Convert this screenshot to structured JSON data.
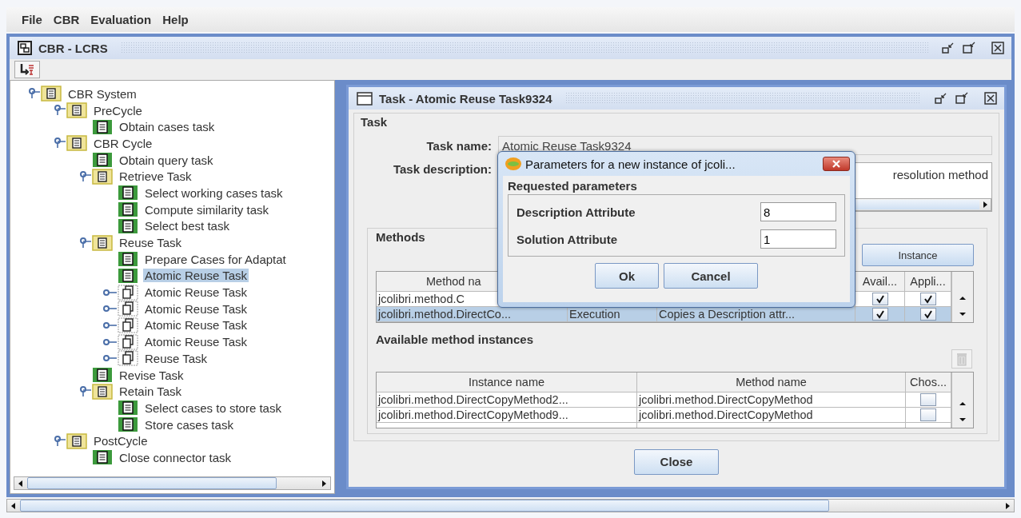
{
  "menu": [
    "File",
    "CBR",
    "Evaluation",
    "Help"
  ],
  "main_window": {
    "title": "CBR - LCRS"
  },
  "tree": [
    {
      "label": "CBR System",
      "kind": "folder",
      "expanded": true,
      "selected": false,
      "children": [
        {
          "label": "PreCycle",
          "kind": "folder",
          "expanded": true,
          "selected": false,
          "children": [
            {
              "label": "Obtain cases task",
              "kind": "task",
              "selected": false
            }
          ]
        },
        {
          "label": "CBR Cycle",
          "kind": "folder",
          "expanded": true,
          "selected": false,
          "children": [
            {
              "label": "Obtain query task",
              "kind": "task",
              "selected": false
            },
            {
              "label": "Retrieve Task",
              "kind": "folder",
              "expanded": true,
              "selected": false,
              "children": [
                {
                  "label": "Select working cases task",
                  "kind": "task",
                  "selected": false
                },
                {
                  "label": "Compute similarity task",
                  "kind": "task",
                  "selected": false
                },
                {
                  "label": "Select best task",
                  "kind": "task",
                  "selected": false
                }
              ]
            },
            {
              "label": "Reuse Task",
              "kind": "folder",
              "expanded": true,
              "selected": false,
              "children": [
                {
                  "label": "Prepare Cases for Adaptat",
                  "kind": "task",
                  "selected": false
                },
                {
                  "label": "Atomic Reuse Task",
                  "kind": "task",
                  "selected": true
                },
                {
                  "label": "Atomic Reuse Task",
                  "kind": "instance",
                  "expanded": false,
                  "selected": false
                },
                {
                  "label": "Atomic Reuse Task",
                  "kind": "instance",
                  "expanded": false,
                  "selected": false
                },
                {
                  "label": "Atomic Reuse Task",
                  "kind": "instance",
                  "expanded": false,
                  "selected": false
                },
                {
                  "label": "Atomic Reuse Task",
                  "kind": "instance",
                  "expanded": false,
                  "selected": false
                },
                {
                  "label": "Reuse Task",
                  "kind": "instance",
                  "expanded": false,
                  "selected": false
                }
              ]
            },
            {
              "label": "Revise Task",
              "kind": "task",
              "selected": false
            },
            {
              "label": "Retain Task",
              "kind": "folder",
              "expanded": true,
              "selected": false,
              "children": [
                {
                  "label": "Select cases to store task",
                  "kind": "task",
                  "selected": false
                },
                {
                  "label": "Store cases task",
                  "kind": "task",
                  "selected": false
                }
              ]
            }
          ]
        },
        {
          "label": "PostCycle",
          "kind": "folder",
          "expanded": true,
          "selected": false,
          "children": [
            {
              "label": "Close connector task",
              "kind": "task",
              "selected": false
            }
          ]
        }
      ]
    }
  ],
  "task_window": {
    "title": "Task - Atomic Reuse Task9324",
    "section": "Task",
    "task_name_label": "Task name:",
    "task_name": "Atomic Reuse Task9324",
    "task_description_label": "Task description:",
    "task_description": "resolution method",
    "methods_section": "Methods",
    "instance_button": "Instance",
    "methods_table": {
      "header": {
        "method_name": "Method na",
        "available": "Avail...",
        "applicable": "Appli..."
      },
      "rows": [
        {
          "selected": false,
          "method_name": "jcolibri.method.C",
          "available": true,
          "applicable": true
        },
        {
          "selected": true,
          "method_name": "jcolibri.method.DirectCo...",
          "type": "Execution",
          "description": "Copies a Description attr...",
          "available": true,
          "applicable": true
        }
      ]
    },
    "instances_label": "Available method instances",
    "instances_table": {
      "header": {
        "instance_name": "Instance name",
        "method_name": "Method name",
        "chosen": "Chos..."
      },
      "rows": [
        {
          "instance_name": "jcolibri.method.DirectCopyMethod2...",
          "method_name": "jcolibri.method.DirectCopyMethod",
          "chosen": false
        },
        {
          "instance_name": "jcolibri.method.DirectCopyMethod9...",
          "method_name": "jcolibri.method.DirectCopyMethod",
          "chosen": false
        }
      ]
    },
    "close_button": "Close"
  },
  "dialog": {
    "title": "Parameters for a new instance of jcoli...",
    "section": "Requested parameters",
    "parameters": [
      {
        "label": "Description Attribute",
        "value": "8"
      },
      {
        "label": "Solution Attribute",
        "value": "1"
      }
    ],
    "buttons": [
      "Ok",
      "Cancel"
    ]
  }
}
